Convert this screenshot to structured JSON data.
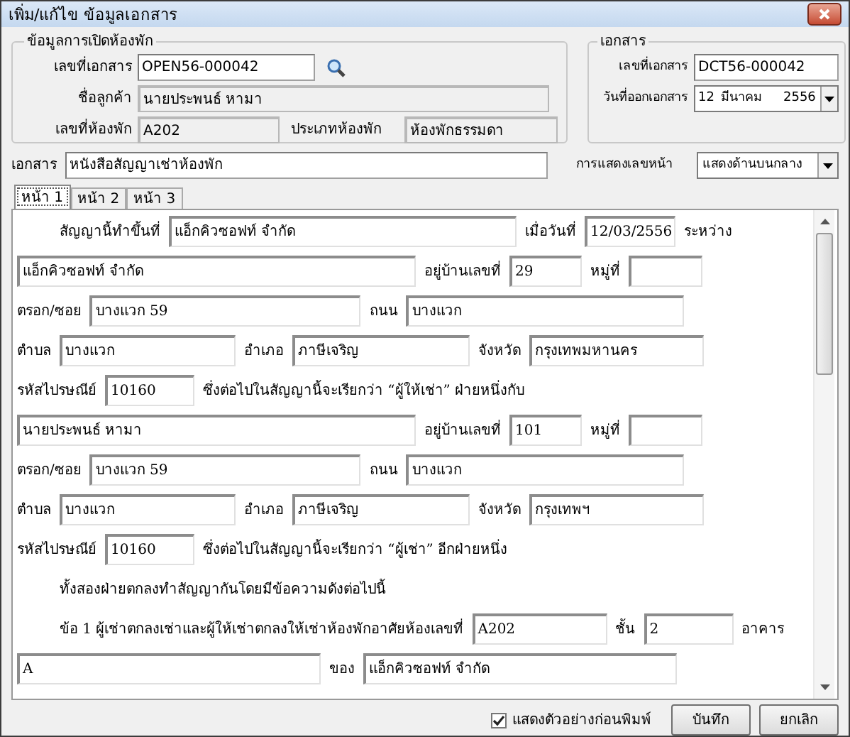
{
  "window": {
    "title": "เพิ่ม/แก้ไข ข้อมูลเอกสาร"
  },
  "room_group": {
    "title": "ข้อมูลการเปิดห้องพัก",
    "doc_no": {
      "label": "เลขที่เอกสาร",
      "value": "OPEN56-000042",
      "disabled": false
    },
    "customer": {
      "label": "ชื่อลูกค้า",
      "value": "นายประพนธ์  หามา",
      "disabled": true
    },
    "room_no": {
      "label": "เลขที่ห้องพัก",
      "value": "A202",
      "disabled": true
    },
    "room_type": {
      "label": "ประเภทห้องพัก",
      "value": "ห้องพักธรรมดา",
      "disabled": true
    }
  },
  "doc_group": {
    "title": "เอกสาร",
    "doc_no": {
      "label": "เลขที่เอกสาร",
      "value": "DCT56-000042"
    },
    "date": {
      "label": "วันที่ออกเอกสาร",
      "day": "12",
      "month": "มีนาคม",
      "year": "2556"
    }
  },
  "document": {
    "label": "เอกสาร",
    "value": "หนังสือสัญญาเช่าห้องพัก"
  },
  "page_number": {
    "label": "การแสดงเลขหน้า",
    "value": "แสดงด้านบนกลาง"
  },
  "tabs": [
    {
      "label": "หน้า 1",
      "selected": true
    },
    {
      "label": "หน้า 2",
      "selected": false
    },
    {
      "label": "หน้า 3",
      "selected": false
    }
  ],
  "contract_rows": [
    [
      {
        "kind": "label",
        "text": "สัญญานี้ทำขึ้นที่"
      },
      {
        "kind": "field",
        "value": "แอ็กคิวซอฟท์ จำกัด"
      },
      {
        "kind": "label",
        "text": "เมื่อวันที่"
      },
      {
        "kind": "field",
        "value": "12/03/2556"
      },
      {
        "kind": "label",
        "text": "ระหว่าง"
      }
    ],
    [
      {
        "kind": "field",
        "value": "แอ็กคิวซอฟท์ จำกัด"
      },
      {
        "kind": "label",
        "text": "อยู่บ้านเลขที่"
      },
      {
        "kind": "field",
        "value": "29"
      },
      {
        "kind": "label",
        "text": "หมู่ที่"
      },
      {
        "kind": "field"
      }
    ],
    [
      {
        "kind": "label",
        "text": "ตรอก/ซอย"
      },
      {
        "kind": "field",
        "value": "บางแวก 59"
      },
      {
        "kind": "label",
        "text": "ถนน"
      },
      {
        "kind": "field",
        "value": "บางแวก"
      }
    ],
    [
      {
        "kind": "label",
        "text": "ตำบล"
      },
      {
        "kind": "field",
        "value": "บางแวก"
      },
      {
        "kind": "label",
        "text": "อำเภอ"
      },
      {
        "kind": "field",
        "value": "ภาษีเจริญ"
      },
      {
        "kind": "label",
        "text": "จังหวัด"
      },
      {
        "kind": "field",
        "value": "กรุงเทพมหานคร"
      }
    ],
    [
      {
        "kind": "label",
        "text": "รหัสไปรษณีย์"
      },
      {
        "kind": "field",
        "value": "10160"
      },
      {
        "kind": "label",
        "text": "ซึ่งต่อไปในสัญญานี้จะเรียกว่า “ผู้ให้เช่า” ฝ่ายหนึ่งกับ"
      }
    ],
    [
      {
        "kind": "field",
        "value": "นายประพนธ์  หามา"
      },
      {
        "kind": "label",
        "text": "อยู่บ้านเลขที่"
      },
      {
        "kind": "field",
        "value": "101"
      },
      {
        "kind": "label",
        "text": "หมู่ที่"
      },
      {
        "kind": "field"
      }
    ],
    [
      {
        "kind": "label",
        "text": "ตรอก/ซอย"
      },
      {
        "kind": "field",
        "value": "บางแวก 59"
      },
      {
        "kind": "label",
        "text": "ถนน"
      },
      {
        "kind": "field",
        "value": "บางแวก"
      }
    ],
    [
      {
        "kind": "label",
        "text": "ตำบล"
      },
      {
        "kind": "field",
        "value": "บางแวก"
      },
      {
        "kind": "label",
        "text": "อำเภอ"
      },
      {
        "kind": "field",
        "value": "ภาษีเจริญ"
      },
      {
        "kind": "label",
        "text": "จังหวัด"
      },
      {
        "kind": "field",
        "value": "กรุงเทพฯ"
      }
    ],
    [
      {
        "kind": "label",
        "text": "รหัสไปรษณีย์"
      },
      {
        "kind": "field",
        "value": "10160"
      },
      {
        "kind": "label",
        "text": "ซึ่งต่อไปในสัญญานี้จะเรียกว่า “ผู้เช่า” อีกฝ่ายหนึ่ง"
      }
    ],
    [
      {
        "kind": "label",
        "text": "ทั้งสองฝ่ายตกลงทำสัญญากันโดยมีข้อความดังต่อไปนี้"
      }
    ],
    [
      {
        "kind": "label",
        "text": "ข้อ 1  ผู้เช่าตกลงเช่าและผู้ให้เช่าตกลงให้เช่าห้องพักอาศัยห้องเลขที่"
      },
      {
        "kind": "field",
        "value": "A202"
      },
      {
        "kind": "label",
        "text": "ชั้น"
      },
      {
        "kind": "field",
        "value": "2"
      },
      {
        "kind": "label",
        "text": "อาคาร"
      }
    ],
    [
      {
        "kind": "field",
        "value": "A"
      },
      {
        "kind": "label",
        "text": "ของ"
      },
      {
        "kind": "field",
        "value": "แอ็กคิวซอฟท์ จำกัด"
      }
    ]
  ],
  "preview": {
    "label": "แสดงตัวอย่างก่อนพิมพ์",
    "checked": true
  },
  "buttons": [
    "บันทึก",
    "ยกเลิก"
  ]
}
